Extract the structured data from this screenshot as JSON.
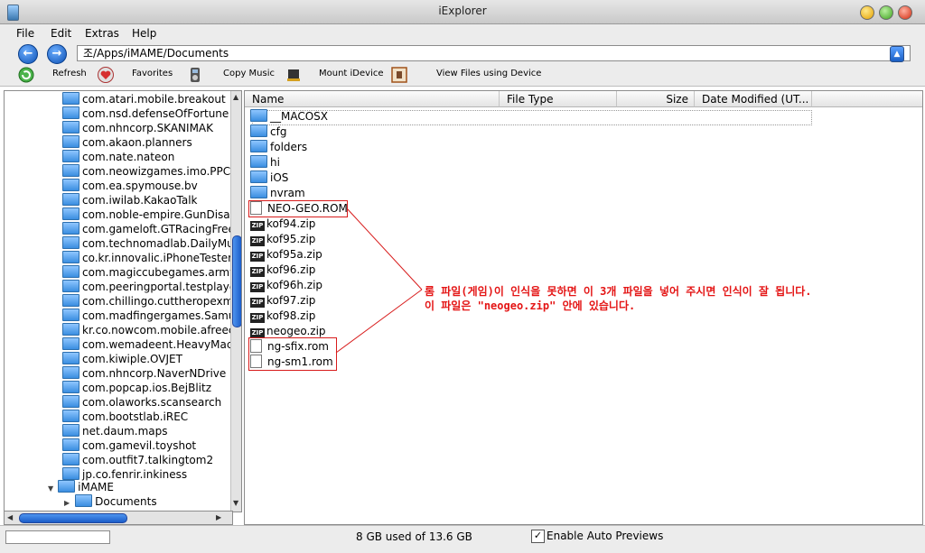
{
  "window": {
    "title": "iExplorer"
  },
  "menu": [
    "File",
    "Edit",
    "Extras",
    "Help"
  ],
  "address": {
    "path": "조/Apps/iMAME/Documents"
  },
  "toolbar": {
    "refresh": "Refresh",
    "favorites": "Favorites",
    "copy_music": "Copy Music",
    "mount": "Mount iDevice",
    "view_files": "View Files using Device"
  },
  "tree": {
    "items": [
      "com.atari.mobile.breakout",
      "com.nsd.defenseOfFortune",
      "com.nhncorp.SKANIMAK",
      "com.akaon.planners",
      "com.nate.nateon",
      "com.neowizgames.imo.PPCI",
      "com.ea.spymouse.bv",
      "com.iwilab.KakaoTalk",
      "com.noble-empire.GunDisas",
      "com.gameloft.GTRacingFreer",
      "com.technomadlab.DailyMus",
      "co.kr.innovalic.iPhoneTester",
      "com.magiccubegames.army",
      "com.peeringportal.testplayer",
      "com.chillingo.cuttheropexma",
      "com.madfingergames.Samur",
      "kr.co.nowcom.mobile.afreeca",
      "com.wemadeent.HeavyMach",
      "com.kiwiple.OVJET",
      "com.nhncorp.NaverNDrive",
      "com.popcap.ios.BejBlitz",
      "com.olaworks.scansearch",
      "com.bootstlab.iREC",
      "net.daum.maps",
      "com.gamevil.toyshot",
      "com.outfit7.talkingtom2",
      "jp.co.fenrir.inkiness"
    ],
    "imame": "iMAME",
    "documents": "Documents"
  },
  "columns": {
    "name": "Name",
    "type": "File Type",
    "size": "Size",
    "modified": "Date Modified (UT..."
  },
  "files": [
    {
      "name": "__MACOSX",
      "kind": "folder"
    },
    {
      "name": "cfg",
      "kind": "folder"
    },
    {
      "name": "folders",
      "kind": "folder"
    },
    {
      "name": "hi",
      "kind": "folder"
    },
    {
      "name": "iOS",
      "kind": "folder"
    },
    {
      "name": "nvram",
      "kind": "folder"
    },
    {
      "name": "NEO-GEO.ROM",
      "kind": "doc"
    },
    {
      "name": "kof94.zip",
      "kind": "zip"
    },
    {
      "name": "kof95.zip",
      "kind": "zip"
    },
    {
      "name": "kof95a.zip",
      "kind": "zip"
    },
    {
      "name": "kof96.zip",
      "kind": "zip"
    },
    {
      "name": "kof96h.zip",
      "kind": "zip"
    },
    {
      "name": "kof97.zip",
      "kind": "zip"
    },
    {
      "name": "kof98.zip",
      "kind": "zip"
    },
    {
      "name": "neogeo.zip",
      "kind": "zip"
    },
    {
      "name": "ng-sfix.rom",
      "kind": "doc"
    },
    {
      "name": "ng-sm1.rom",
      "kind": "doc"
    }
  ],
  "annotation": {
    "line1": "롬 파일(게임)이 인식을 못하면 이 3개 파일을 넣어 주시면 인식이 잘 됩니다.",
    "line2": "이 파일은 \"neogeo.zip\" 안에 있습니다.",
    "color": "#e41515"
  },
  "status": {
    "storage": "8 GB used of 13.6 GB",
    "auto_previews": "Enable Auto Previews",
    "auto_previews_checked": true
  },
  "icons": [
    "back-arrow-icon",
    "forward-arrow-icon",
    "refresh-icon",
    "favorites-heart-icon",
    "copy-music-icon",
    "mount-idevice-icon",
    "view-files-icon",
    "folder-icon",
    "zip-file-icon",
    "document-icon"
  ]
}
